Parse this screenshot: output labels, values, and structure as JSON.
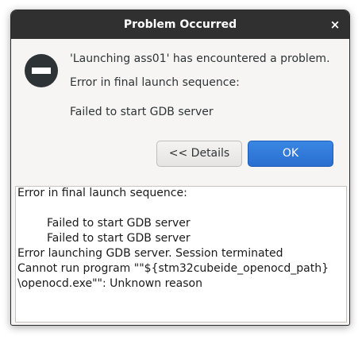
{
  "dialog": {
    "title": "Problem Occurred",
    "close_label": "×",
    "icon": "error-stop-icon"
  },
  "message": {
    "headline": "'Launching ass01' has encountered a problem.",
    "reason": "Error in final launch sequence:",
    "detail": "Failed to start GDB server"
  },
  "buttons": {
    "details_label": "<< Details",
    "ok_label": "OK"
  },
  "details": {
    "lines": [
      "Error in final launch sequence:",
      "",
      "Failed to start GDB server",
      "Failed to start GDB server",
      "Error launching GDB server. Session terminated",
      "Cannot run program \"\"${stm32cubeide_openocd_path}",
      "\\openocd.exe\"\": Unknown reason"
    ]
  },
  "colors": {
    "titlebar": "#303030",
    "accent": "#2a6fd0",
    "background": "#f6f5f4"
  }
}
